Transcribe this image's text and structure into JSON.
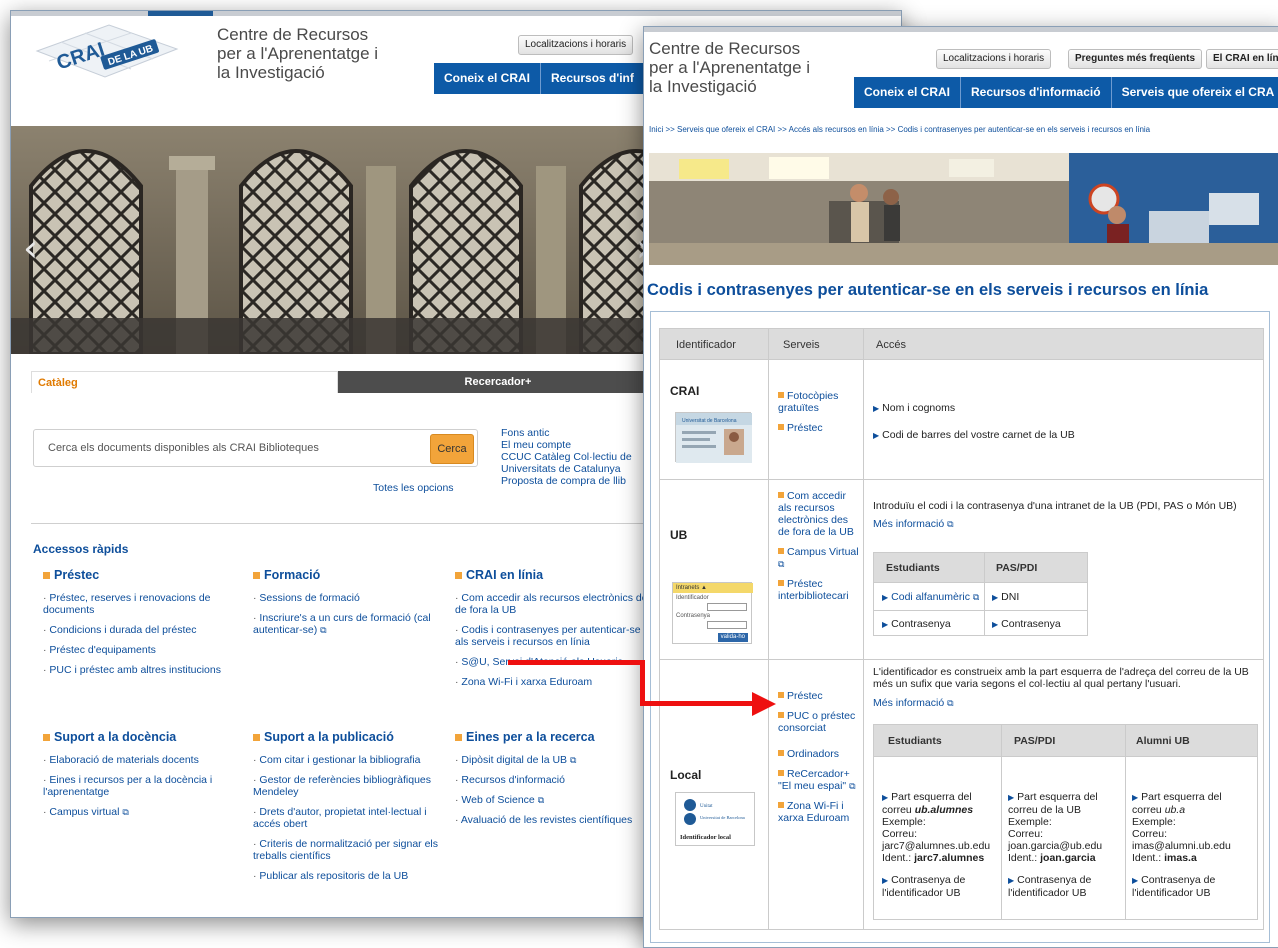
{
  "brand": {
    "line1": "Centre de Recursos",
    "line2": "per a l'Aprenentatge i",
    "line3": "la Investigació",
    "logo_top": "CRAI",
    "logo_bottom": "DE LA UB"
  },
  "win1": {
    "toolbar": {
      "locations": "Localitzacions i horaris"
    },
    "nav": [
      "Coneix el CRAI",
      "Recursos d'inf"
    ],
    "slider": {
      "prev": "‹",
      "next": "›"
    },
    "tabs": {
      "catalog": "Catàleg",
      "recercador": "Recercador+"
    },
    "search": {
      "placeholder": "Cerca els documents disponibles als CRAI Biblioteques",
      "button": "Cerca",
      "all_options": "Totes les opcions"
    },
    "links": [
      "Fons antic",
      "El meu compte",
      "CCUC Catàleg Col·lectiu de",
      "Universitats de Catalunya",
      "Proposta de compra de llib"
    ],
    "quick_title": "Accessos ràpids",
    "columns": [
      {
        "title": "Préstec",
        "items": [
          "Préstec, reserves i renovacions de documents",
          "Condicions i durada del préstec",
          "Préstec d'equipaments",
          "PUC i préstec amb altres institucions"
        ]
      },
      {
        "title": "Formació",
        "items": [
          "Sessions de formació",
          "Inscriure's a un curs de formació (cal autenticar-se)"
        ]
      },
      {
        "title": "CRAI en línia",
        "items": [
          "Com accedir als recursos electrònics des de fora la UB",
          "Codis i contrasenyes per autenticar-se als serveis i recursos en línia",
          "S@U, Servei d'Atenció als Usuaris",
          "Zona Wi-Fi i xarxa Eduroam"
        ]
      },
      {
        "title": "Suport a la docència",
        "items": [
          "Elaboració de materials docents",
          "Eines i recursos per a la docència i l'aprenentatge",
          "Campus virtual"
        ]
      },
      {
        "title": "Suport a la publicació",
        "items": [
          "Com citar i gestionar la bibliografia",
          "Gestor de referències bibliogràfiques Mendeley",
          "Drets d'autor, propietat intel·lectual i accés obert",
          "Criteris de normalització per signar els treballs científics",
          "Publicar als repositoris de la UB"
        ]
      },
      {
        "title": "Eines per a la recerca",
        "items": [
          "Dipòsit digital de la UB",
          "Recursos d'informació",
          "Web of Science",
          "Avaluació de les revistes científiques"
        ]
      }
    ]
  },
  "win2": {
    "toolbar": [
      "Localitzacions i horaris",
      "Preguntes més freqüents",
      "El CRAI en líni"
    ],
    "nav": [
      "Coneix el CRAI",
      "Recursos d'informació",
      "Serveis que ofereix el CRA"
    ],
    "breadcrumb": "Inici >> Serveis que ofereix el CRAI >> Accés als recursos en línia >> Codis i contrasenyes per autenticar-se en els serveis i recursos en línia",
    "title": "Codis i contrasenyes per autenticar-se en els serveis i recursos en línia",
    "table": {
      "headers": [
        "Identificador",
        "Serveis",
        "Accés"
      ],
      "crai": {
        "id": "CRAI",
        "card": "Universitat de Barcelona",
        "services": [
          "Fotocòpies gratuïtes",
          "Préstec"
        ],
        "access": [
          "Nom i cognoms",
          "Codi de barres del vostre carnet de la UB"
        ]
      },
      "ub": {
        "id": "UB",
        "login_title": "Intranets ▲",
        "login_user": "Identificador",
        "login_pass": "Contrasenya",
        "login_btn": "valida-ho",
        "services": [
          "Com accedir als recursos electrònics des de fora de la UB",
          "Campus Virtual",
          "Préstec interbibliotecari"
        ],
        "intro": "Introduïu el codi i la contrasenya d'una intranet de la UB (PDI, PAS o Món UB)",
        "more": "Més informació",
        "sub_headers": [
          "Estudiants",
          "PAS/PDI"
        ],
        "sub_rows": [
          [
            "Codi alfanumèric",
            "DNI"
          ],
          [
            "Contrasenya",
            "Contrasenya"
          ]
        ]
      },
      "local": {
        "id": "Local",
        "logo_text": "Identificador local",
        "logo_l1": "Unitat",
        "logo_l2": "Universitat de Barcelona",
        "services": [
          "Préstec",
          "PUC o préstec consorciat",
          "Ordinadors",
          "ReCercador+ \"El meu espai\"",
          "Zona Wi-Fi i xarxa Eduroam"
        ],
        "intro": "L'identificador es construeix amb la part esquerra de l'adreça del correu de la UB més un sufix que varia segons el col·lectiu al qual pertany l'usuari.",
        "more": "Més informació",
        "sub_headers": [
          "Estudiants",
          "PAS/PDI",
          "Alumni UB"
        ],
        "cols": [
          {
            "l1": "Part esquerra del",
            "l2": "correu",
            "suffix": "ub.alumnes",
            "ex": "Exemple:",
            "mail_l": "Correu:",
            "mail": "jarc7@alumnes.ub.edu",
            "ident_l": "Ident.:",
            "ident": "jarc7.alumnes",
            "pw": "Contrasenya de l'identificador UB"
          },
          {
            "l1": "Part esquerra del",
            "l2": "correu de la UB",
            "suffix": "",
            "ex": "Exemple:",
            "mail_l": "Correu:",
            "mail": "joan.garcia@ub.edu",
            "ident_l": "Ident.:",
            "ident": "joan.garcia",
            "pw": "Contrasenya de l'identificador UB"
          },
          {
            "l1": "Part esquerra del",
            "l2": "correu",
            "suffix": "ub.a",
            "ex": "Exemple:",
            "mail_l": "Correu:",
            "mail": "imas@alumni.ub.edu",
            "ident_l": "Ident.:",
            "ident": "imas.a",
            "pw": "Contrasenya de l'identificador UB"
          }
        ]
      }
    }
  },
  "colors": {
    "accent": "#0d5aa7",
    "orange": "#f2a43a",
    "link": "#0d4e9b",
    "red_arrow": "#ee1010"
  }
}
